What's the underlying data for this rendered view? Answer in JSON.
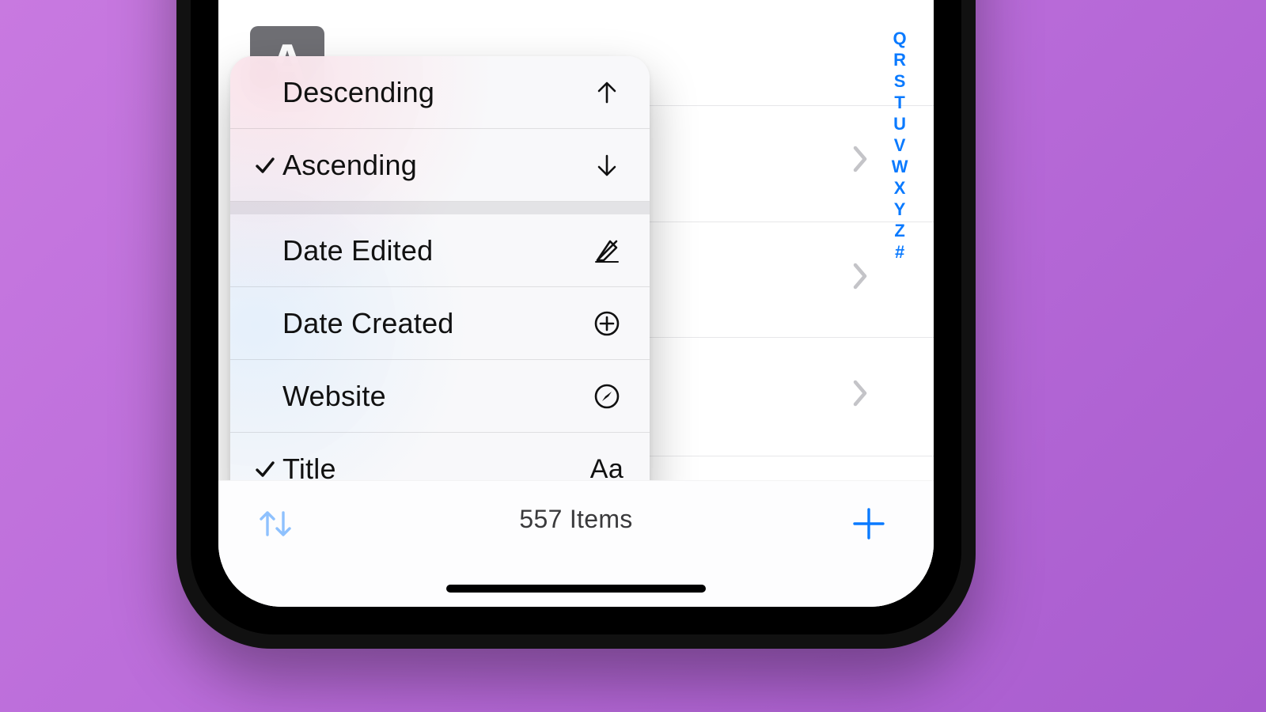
{
  "sort_menu": {
    "direction": {
      "descending": {
        "label": "Descending",
        "checked": false
      },
      "ascending": {
        "label": "Ascending",
        "checked": true
      }
    },
    "fields": {
      "date_edited": {
        "label": "Date Edited",
        "checked": false
      },
      "date_created": {
        "label": "Date Created",
        "checked": false
      },
      "website": {
        "label": "Website",
        "checked": false
      },
      "title": {
        "label": "Title",
        "checked": true
      }
    },
    "title_icon_text": "Aa"
  },
  "index_letters": [
    "Q",
    "R",
    "S",
    "T",
    "U",
    "V",
    "W",
    "X",
    "Y",
    "Z",
    "#"
  ],
  "list": {
    "top_avatar_letter": "A"
  },
  "toolbar": {
    "item_count_label": "557 Items"
  },
  "colors": {
    "accent": "#0a7aff"
  }
}
